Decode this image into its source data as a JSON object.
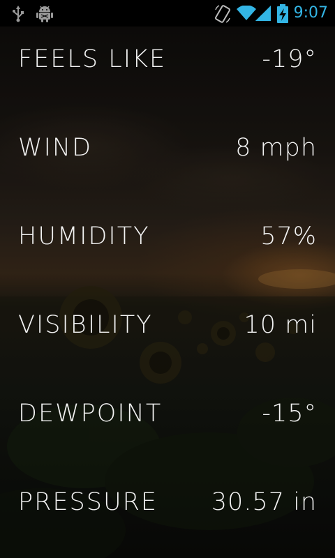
{
  "status_bar": {
    "time": "9:07",
    "icons": [
      "usb-icon",
      "android-debug-icon",
      "auto-rotate-icon",
      "wifi-icon",
      "signal-icon",
      "battery-charging-icon"
    ],
    "accent_color": "#33b5e5"
  },
  "details": [
    {
      "label": "FEELS LIKE",
      "value": "-19°"
    },
    {
      "label": "WIND",
      "value": "8 mph"
    },
    {
      "label": "HUMIDITY",
      "value": "57%"
    },
    {
      "label": "VISIBILITY",
      "value": "10 mi"
    },
    {
      "label": "DEWPOINT",
      "value": "-15°"
    },
    {
      "label": "PRESSURE",
      "value": "30.57 in"
    }
  ]
}
